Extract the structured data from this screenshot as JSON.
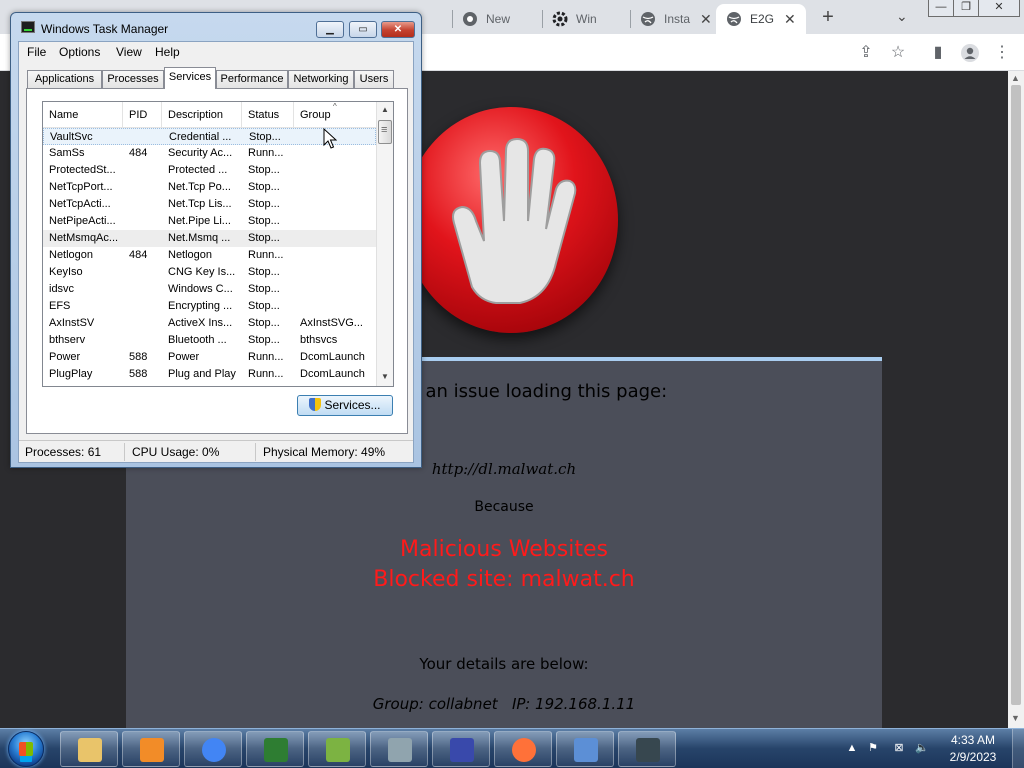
{
  "browser": {
    "tabs": [
      {
        "title": "New"
      },
      {
        "title": "Win"
      },
      {
        "title": "Insta"
      },
      {
        "title": "E2G"
      }
    ],
    "new_tab_symbol": "+",
    "window_controls": {
      "minimize": "—",
      "restore": "❐",
      "close": "✕"
    }
  },
  "page": {
    "issue_message": "ms to be an issue loading this page:",
    "blocked_url": "http://dl.malwat.ch",
    "because_label": "Because",
    "reason_category": "Malicious Websites",
    "reason_site": "Blocked site: malwat.ch",
    "details_heading": "Your details are below:",
    "group_label": "Group: collabnet",
    "ip_label": "IP: 192.168.1.11",
    "colors": {
      "reason": "#ff1a1a",
      "panel": "#4b4e59",
      "stop_sign": "#e1141b"
    }
  },
  "task_manager": {
    "title": "Windows Task Manager",
    "menu": [
      "File",
      "Options",
      "View",
      "Help"
    ],
    "tabs": [
      "Applications",
      "Processes",
      "Services",
      "Performance",
      "Networking",
      "Users"
    ],
    "selected_tab": "Services",
    "columns": [
      "Name",
      "PID",
      "Description",
      "Status",
      "Group"
    ],
    "services": [
      {
        "name": "VaultSvc",
        "pid": "",
        "description": "Credential ...",
        "status": "Stop...",
        "group": ""
      },
      {
        "name": "SamSs",
        "pid": "484",
        "description": "Security Ac...",
        "status": "Runn...",
        "group": ""
      },
      {
        "name": "ProtectedSt...",
        "pid": "",
        "description": "Protected ...",
        "status": "Stop...",
        "group": ""
      },
      {
        "name": "NetTcpPort...",
        "pid": "",
        "description": "Net.Tcp Po...",
        "status": "Stop...",
        "group": ""
      },
      {
        "name": "NetTcpActi...",
        "pid": "",
        "description": "Net.Tcp Lis...",
        "status": "Stop...",
        "group": ""
      },
      {
        "name": "NetPipeActi...",
        "pid": "",
        "description": "Net.Pipe Li...",
        "status": "Stop...",
        "group": ""
      },
      {
        "name": "NetMsmqAc...",
        "pid": "",
        "description": "Net.Msmq ...",
        "status": "Stop...",
        "group": ""
      },
      {
        "name": "Netlogon",
        "pid": "484",
        "description": "Netlogon",
        "status": "Runn...",
        "group": ""
      },
      {
        "name": "KeyIso",
        "pid": "",
        "description": "CNG Key Is...",
        "status": "Stop...",
        "group": ""
      },
      {
        "name": "idsvc",
        "pid": "",
        "description": "Windows C...",
        "status": "Stop...",
        "group": ""
      },
      {
        "name": "EFS",
        "pid": "",
        "description": "Encrypting ...",
        "status": "Stop...",
        "group": ""
      },
      {
        "name": "AxInstSV",
        "pid": "",
        "description": "ActiveX Ins...",
        "status": "Stop...",
        "group": "AxInstSVG..."
      },
      {
        "name": "bthserv",
        "pid": "",
        "description": "Bluetooth ...",
        "status": "Stop...",
        "group": "bthsvcs"
      },
      {
        "name": "Power",
        "pid": "588",
        "description": "Power",
        "status": "Runn...",
        "group": "DcomLaunch"
      },
      {
        "name": "PlugPlay",
        "pid": "588",
        "description": "Plug and Play",
        "status": "Runn...",
        "group": "DcomLaunch"
      }
    ],
    "services_button": "Services...",
    "status_processes": "Processes: 61",
    "status_cpu": "CPU Usage: 0%",
    "status_memory": "Physical Memory: 49%"
  },
  "taskbar": {
    "time": "4:33 AM",
    "date": "2/9/2023",
    "pinned": [
      "explorer-icon",
      "media-player-icon",
      "chrome-icon",
      "csharp-editor-icon",
      "notepad-plus-plus-icon",
      "text-editor-icon",
      "visual-basic-icon",
      "firefox-icon",
      "remote-desktop-icon",
      "task-manager-icon"
    ]
  }
}
